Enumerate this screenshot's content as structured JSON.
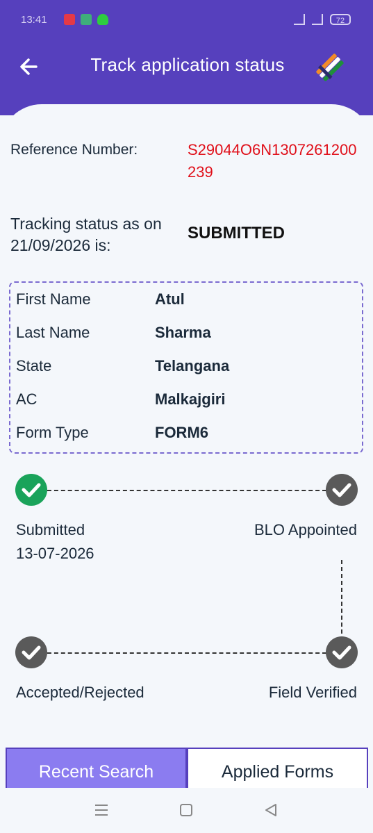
{
  "status_bar": {
    "time": "13:41",
    "battery": "72"
  },
  "header": {
    "title": "Track application status"
  },
  "reference": {
    "label": "Reference Number:",
    "value": "S29044O6N1307261200239"
  },
  "tracking": {
    "label": "Tracking status as on 21/09/2026 is:",
    "value": "SUBMITTED"
  },
  "details": [
    {
      "key": "First Name",
      "value": "Atul"
    },
    {
      "key": "Last Name",
      "value": "Sharma"
    },
    {
      "key": "State",
      "value": "Telangana"
    },
    {
      "key": "AC",
      "value": "Malkajgiri"
    },
    {
      "key": "Form Type",
      "value": "FORM6"
    }
  ],
  "steps": {
    "submitted": {
      "label": "Submitted",
      "date": "13-07-2026",
      "state": "done",
      "color": "#1aa35a"
    },
    "blo": {
      "label": "BLO Appointed",
      "state": "pending",
      "color": "#5a5a5a"
    },
    "verified": {
      "label": "Field Verified",
      "state": "pending",
      "color": "#5a5a5a"
    },
    "accepted": {
      "label": "Accepted/Rejected",
      "state": "pending",
      "color": "#5a5a5a"
    }
  },
  "tabs": {
    "recent": "Recent Search",
    "applied": "Applied Forms"
  },
  "colors": {
    "brand": "#5640bd",
    "tab_active": "#8b7cf0",
    "reference": "#e0101a"
  }
}
